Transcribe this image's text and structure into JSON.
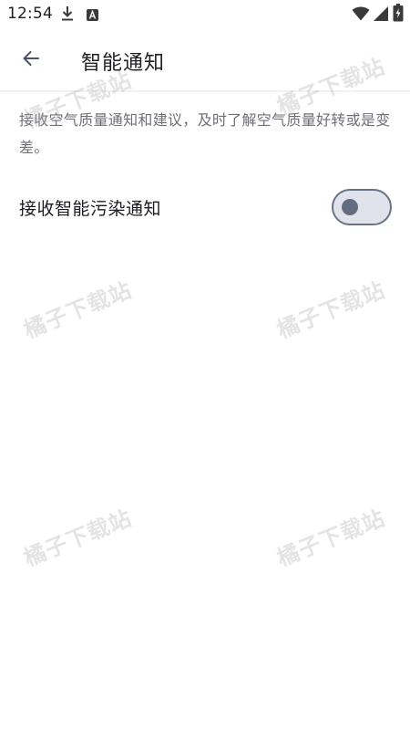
{
  "status_bar": {
    "time": "12:54",
    "icons": [
      "download-icon",
      "a-notification-icon",
      "wifi-icon",
      "signal-icon",
      "battery-icon"
    ]
  },
  "app_bar": {
    "back_icon": "arrow-left-icon",
    "title": "智能通知"
  },
  "content": {
    "description": "接收空气质量通知和建议，及时了解空气质量好转或是变差。",
    "settings": [
      {
        "label": "接收智能污染通知",
        "toggle_on": false
      }
    ]
  },
  "watermark": "橘子下载站",
  "colors": {
    "background": "#ffffff",
    "toggle_track": "#e1e3ec",
    "toggle_border": "#6a7386",
    "toggle_thumb": "#646d80",
    "description_text": "#6f6f78"
  }
}
